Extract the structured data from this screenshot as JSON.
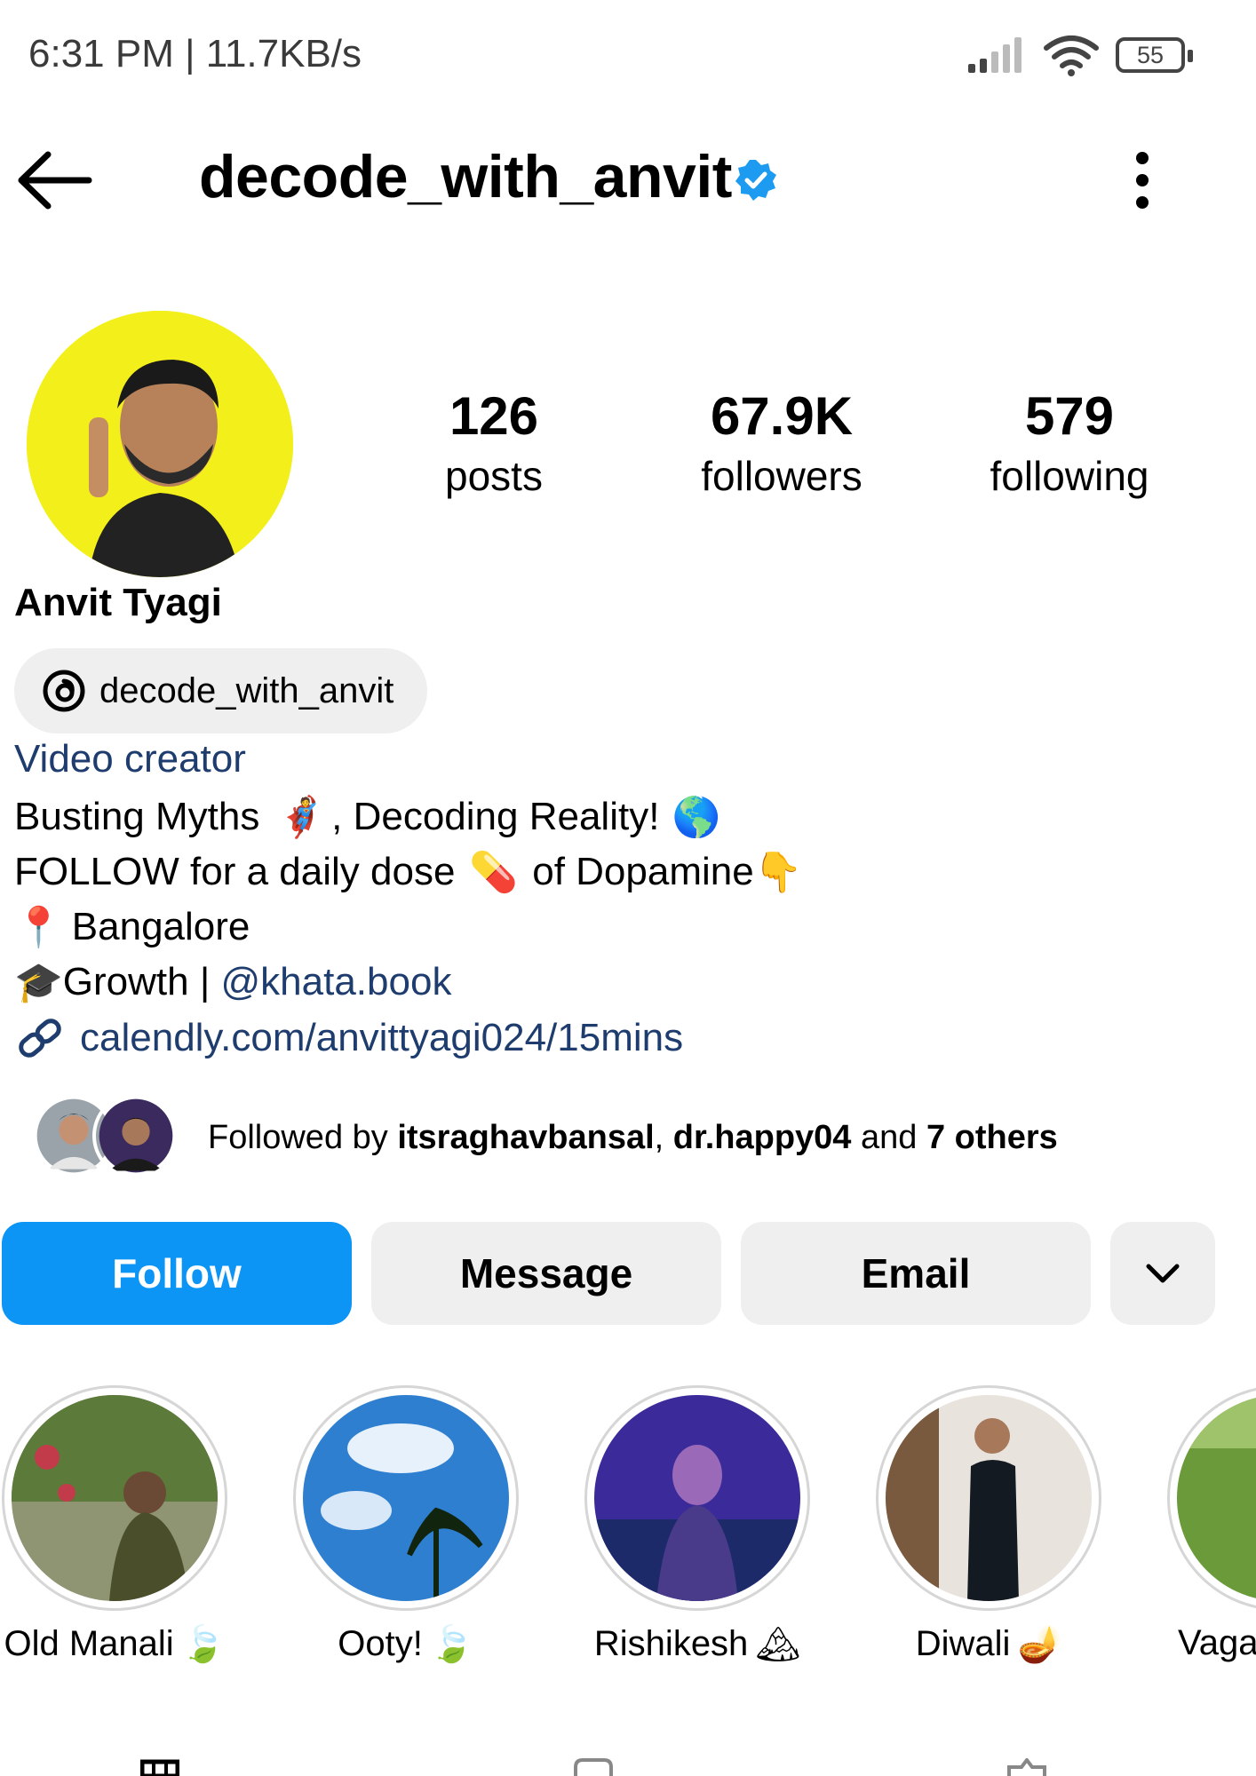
{
  "status_bar": {
    "time_text": "6:31 PM | 11.7KB/s",
    "battery_level": "55",
    "icons": [
      "signal-icon",
      "wifi-icon",
      "battery-icon"
    ]
  },
  "header": {
    "username": "decode_with_anvit",
    "verified_icon": "verified-badge-icon",
    "back_icon": "back-arrow-icon",
    "more_icon": "more-vertical-icon"
  },
  "profile": {
    "stats": [
      {
        "value": "126",
        "label": "posts"
      },
      {
        "value": "67.9K",
        "label": "followers"
      },
      {
        "value": "579",
        "label": "following"
      }
    ],
    "display_name": "Anvit Tyagi",
    "threads_handle": "decode_with_anvit",
    "category": "Video creator",
    "bio": {
      "line1_a": "Busting Myths",
      "line1_b": ", Decoding Reality!",
      "line2_a": "FOLLOW for a daily dose",
      "line2_b": "of Dopamine",
      "line3": "Bangalore",
      "line4_text": "Growth | ",
      "line4_mention": "@khata.book",
      "link": "calendly.com/anvittyagi024/15mins"
    },
    "followed_by": {
      "prefix": "Followed by ",
      "user1": "itsraghavbansal",
      "sep": ", ",
      "user2": "dr.happy04",
      "and": " and ",
      "others": "7 others"
    }
  },
  "actions": {
    "follow": "Follow",
    "message": "Message",
    "email": "Email"
  },
  "highlights": [
    {
      "label": "Old Manali"
    },
    {
      "label": "Ooty!"
    },
    {
      "label": "Rishikesh"
    },
    {
      "label": "Diwali"
    },
    {
      "label": "Vaga"
    }
  ],
  "colors": {
    "accent": "#0d95f6",
    "link": "#1e3d6e",
    "avatar_bg": "#f3ef1a",
    "verified": "#1d9bf0"
  }
}
